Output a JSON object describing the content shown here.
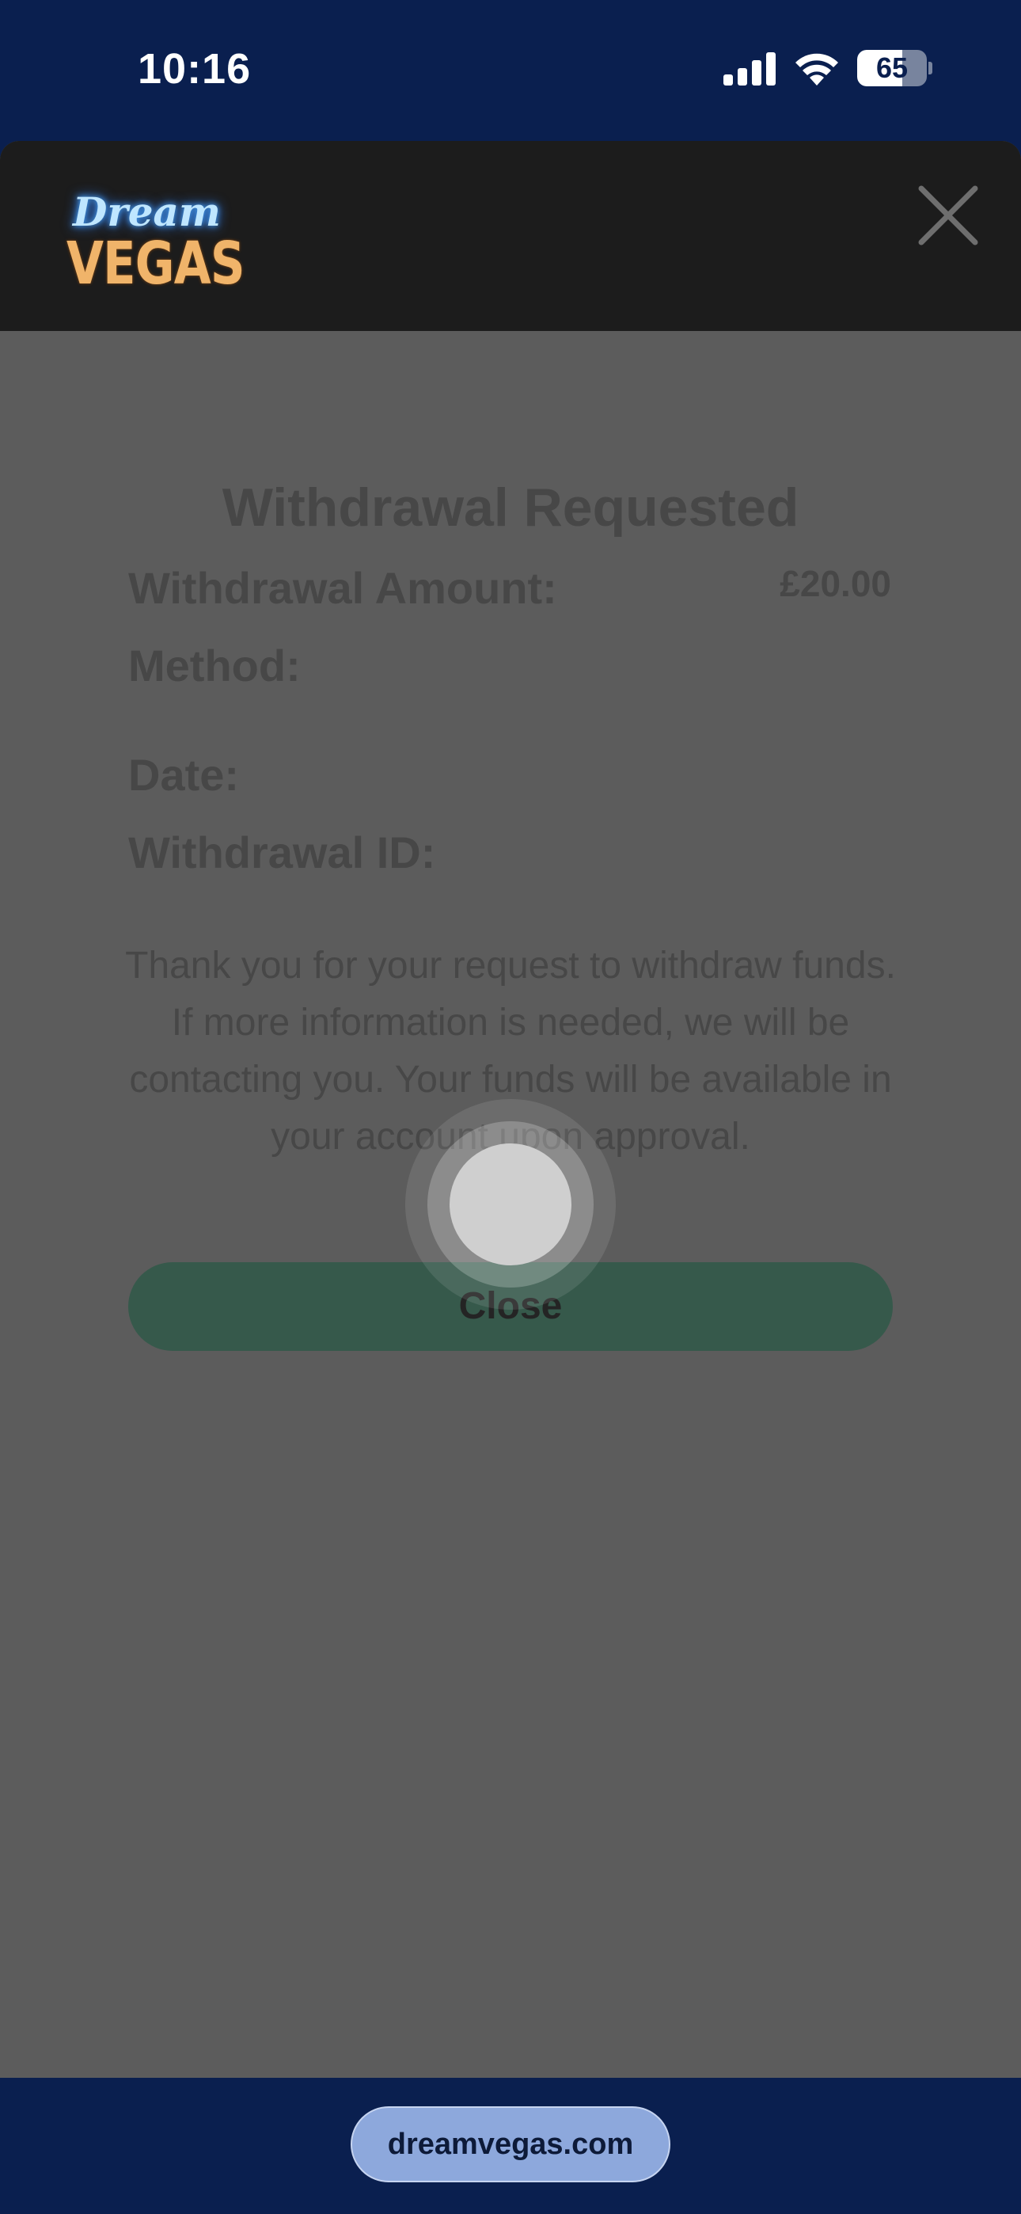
{
  "status_bar": {
    "time": "10:16",
    "battery": "65",
    "icons": [
      "signal-icon",
      "wifi-icon",
      "battery-icon"
    ]
  },
  "header": {
    "logo_line1": "Dream",
    "logo_line2": "VEGAS",
    "close_icon": "close-icon"
  },
  "modal": {
    "title": "Withdrawal Requested",
    "amount_label": "Withdrawal Amount:",
    "amount_value": "£20.00",
    "method_label": "Method:",
    "date_label": "Date:",
    "withdrawal_id_label": "Withdrawal ID:",
    "message": "Thank you for your request to withdraw funds. If more information is needed, we will be contacting you. Your funds will be available in your account upon approval.",
    "close_label": "Close"
  },
  "browser": {
    "url": "dreamvegas.com"
  },
  "colors": {
    "status_bg": "#0a1f4f",
    "header_bg": "#1c1c1c",
    "overlay_bg": "#5c5c5c",
    "button_bg": "#36594b",
    "url_pill_bg": "#8da8dc"
  }
}
